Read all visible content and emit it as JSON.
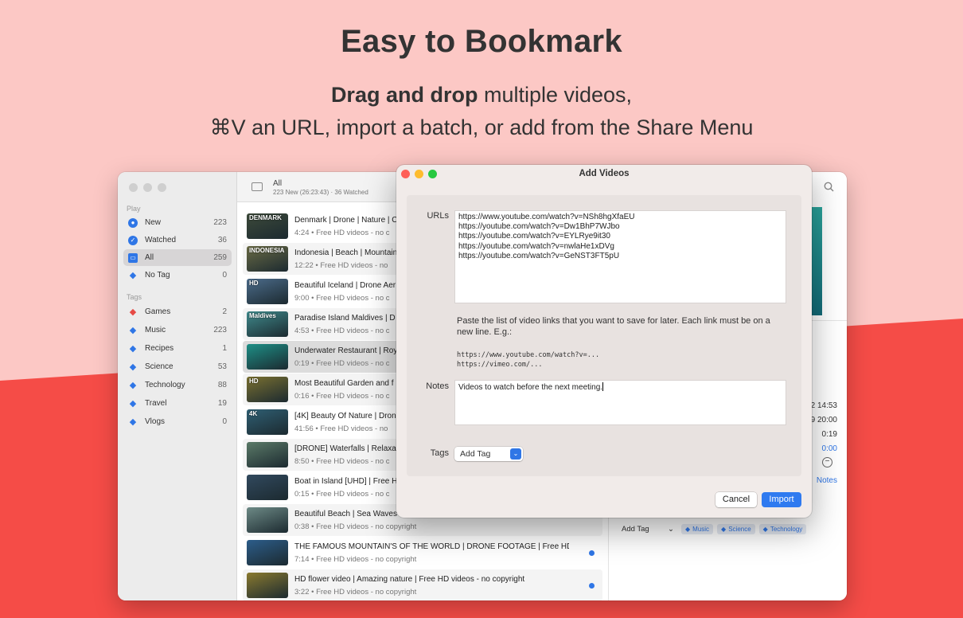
{
  "marketing": {
    "headline": "Easy to Bookmark",
    "sub1_bold": "Drag and drop",
    "sub1_rest": " multiple videos,",
    "sub2": "⌘V an URL, import a batch, or add from the Share Menu"
  },
  "sidebar": {
    "play_section": "Play",
    "play_items": [
      {
        "label": "New",
        "count": "223"
      },
      {
        "label": "Watched",
        "count": "36"
      },
      {
        "label": "All",
        "count": "259"
      },
      {
        "label": "No Tag",
        "count": "0"
      }
    ],
    "tags_section": "Tags",
    "tag_items": [
      {
        "label": "Games",
        "count": "2",
        "color": "#e64a45"
      },
      {
        "label": "Music",
        "count": "223",
        "color": "#2f76e6"
      },
      {
        "label": "Recipes",
        "count": "1",
        "color": "#2f76e6"
      },
      {
        "label": "Science",
        "count": "53",
        "color": "#2f76e6"
      },
      {
        "label": "Technology",
        "count": "88",
        "color": "#2f76e6"
      },
      {
        "label": "Travel",
        "count": "19",
        "color": "#2f76e6"
      },
      {
        "label": "Vlogs",
        "count": "0",
        "color": "#2f76e6"
      }
    ]
  },
  "list_header": {
    "title": "All",
    "subtitle": "223 New (26:23:43) · 36 Watched"
  },
  "videos": [
    {
      "title": "Denmark | Drone | Nature | C",
      "meta": "4:24 • Free HD videos - no c",
      "thumb_label": "DENMARK",
      "thumb_color": "#3d4a3a"
    },
    {
      "title": "Indonesia | Beach | Mountain",
      "meta": "12:22 • Free HD videos - no",
      "thumb_label": "INDONESIA",
      "thumb_color": "#6a6b45"
    },
    {
      "title": "Beautiful Iceland | Drone Aer",
      "meta": "9:00 • Free HD videos - no c",
      "thumb_label": "HD",
      "thumb_color": "#4b6b8a"
    },
    {
      "title": "Paradise Island Maldives | D",
      "meta": "4:53 • Free HD videos - no c",
      "thumb_label": "Maldives",
      "thumb_color": "#3f8a8c"
    },
    {
      "title": "Underwater Restaurant | Roy",
      "meta": "0:19 • Free HD videos - no c",
      "thumb_label": "",
      "thumb_color": "#1d8f86"
    },
    {
      "title": "Most Beautiful Garden and f",
      "meta": "0:16 • Free HD videos - no c",
      "thumb_label": "HD",
      "thumb_color": "#7a7030"
    },
    {
      "title": "[4K] Beauty Of Nature | Dron",
      "meta": "41:56 • Free HD videos - no",
      "thumb_label": "4K",
      "thumb_color": "#2f5f73"
    },
    {
      "title": "[DRONE] Waterfalls | Relaxa",
      "meta": "8:50 • Free HD videos - no c",
      "thumb_label": "",
      "thumb_color": "#5b7a68"
    },
    {
      "title": "Boat in Island [UHD] | Free H",
      "meta": "0:15 • Free HD videos - no c",
      "thumb_label": "",
      "thumb_color": "#31495e"
    },
    {
      "title": "Beautiful Beach | Sea Waves",
      "meta": "0:38 • Free HD videos - no copyright",
      "thumb_label": "",
      "thumb_color": "#6d8a86"
    },
    {
      "title": "THE FAMOUS MOUNTAIN'S OF THE WORLD | DRONE FOOTAGE | Free HD...",
      "meta": "7:14 • Free HD videos - no copyright",
      "thumb_label": "",
      "thumb_color": "#2c5d8a",
      "unread": true
    },
    {
      "title": "HD flower video | Amazing nature | Free HD videos - no copyright",
      "meta": "3:22 • Free HD videos - no copyright",
      "thumb_label": "",
      "thumb_color": "#8a7a2f",
      "unread": true
    }
  ],
  "detail": {
    "values": [
      "2 14:53",
      "9 20:00",
      "0:19",
      "0:00"
    ],
    "notes_link": "Notes",
    "add_tag": "Add Tag",
    "tags": [
      "Music",
      "Science",
      "Technology"
    ]
  },
  "dialog": {
    "title": "Add Videos",
    "urls_label": "URLs",
    "urls_value": "https://www.youtube.com/watch?v=NSh8hgXfaEU\nhttps://youtube.com/watch?v=Dw1BhP7WJbo\nhttps://youtube.com/watch?v=EYLRye9it30\nhttps://youtube.com/watch?v=nwlaHe1xDVg\nhttps://youtube.com/watch?v=GeNST3FT5pU",
    "help_text": "Paste the list of video links that you want to save for later. Each link must be on a new line. E.g.:",
    "help_code": "https://www.youtube.com/watch?v=...\nhttps://vimeo.com/...",
    "notes_label": "Notes",
    "notes_value": "Videos to watch before the next meeting.",
    "tags_label": "Tags",
    "tag_select": "Add Tag",
    "cancel": "Cancel",
    "import": "Import"
  }
}
